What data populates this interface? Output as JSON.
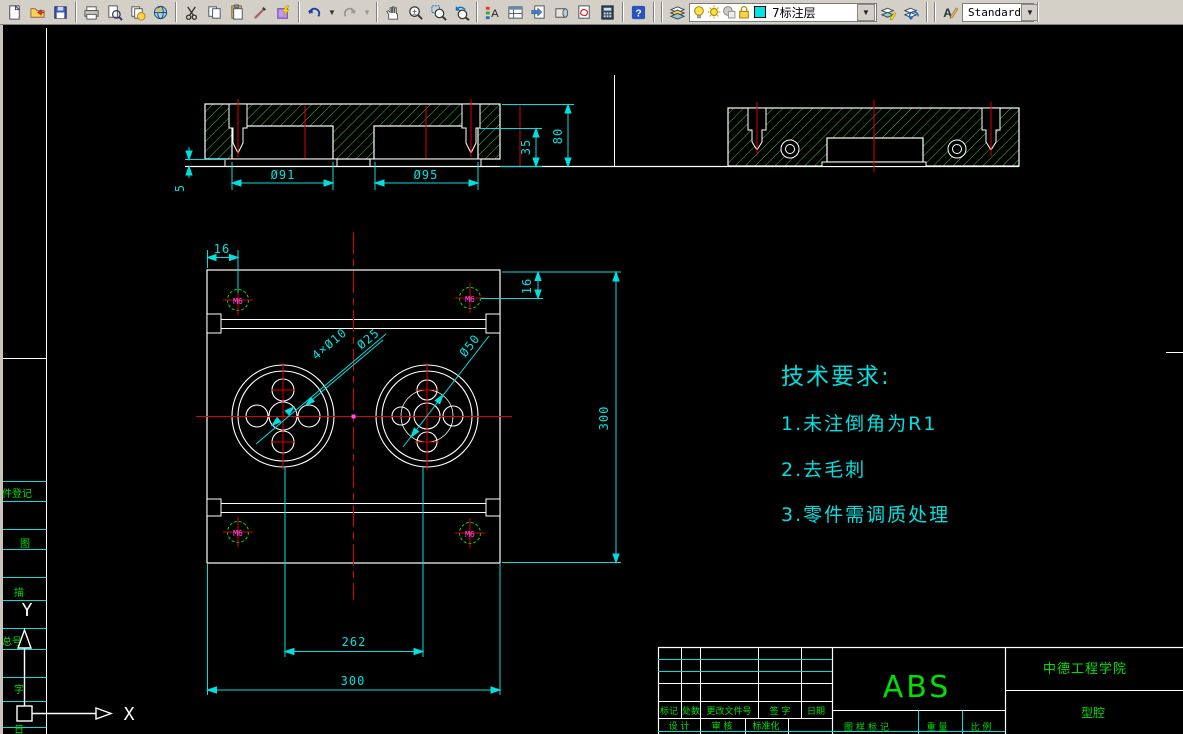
{
  "toolbar": {
    "button_groups": [
      [
        "new-file",
        "open",
        "save"
      ],
      [
        "print",
        "plot-preview",
        "publish",
        "web"
      ],
      [
        "cut",
        "copy",
        "paste",
        "match-properties",
        "block-editor"
      ],
      [
        "undo",
        "undo-dropdown",
        "redo",
        "redo-dropdown"
      ],
      [
        "pan",
        "zoom-realtime",
        "zoom-window",
        "zoom-previous"
      ],
      [
        "properties",
        "design-center",
        "tool-palettes",
        "sheet-set-manager",
        "markup-set-manager",
        "quick-calc"
      ],
      [
        "help"
      ]
    ],
    "layer_panel": {
      "layers_button": "layers",
      "combo": {
        "state_icons": [
          "bulb",
          "sun",
          "vp-freeze",
          "lock"
        ],
        "swatch_color": "#00E5E5",
        "value": "7标注层"
      },
      "after_buttons": [
        "layer-make-current",
        "layer-previous"
      ]
    },
    "style_panel": {
      "text_style_button": "text-style",
      "combo_value": "Standard",
      "dim_style_button": "dim-style"
    }
  },
  "drawing": {
    "dims": {
      "d91": "Ø91",
      "d95": "Ø95",
      "h80": "80",
      "h35": "35",
      "h5": "5",
      "w16_top": "16",
      "h16_right": "16",
      "bolt_circle_holes": "4×Ø10",
      "d25": "Ø25",
      "d50": "Ø50",
      "w262": "262",
      "w300_bottom": "300",
      "h300_right": "300"
    },
    "hole_label": "M6",
    "tech": {
      "title": "技术要求:",
      "items": [
        "1.未注倒角为R1",
        "2.去毛刺",
        "3.零件需调质处理"
      ]
    },
    "title_block": {
      "material": "ABS",
      "company": "中德工程学院",
      "part_name": "型腔",
      "row1": [
        "标记",
        "处数",
        "更改文件号",
        "签 字",
        "日期"
      ],
      "row2": [
        "设 计",
        "审 核",
        "标准化"
      ],
      "bottom": [
        "图样标记",
        "重 量",
        "比 例"
      ]
    },
    "left_fragments": [
      "件登记",
      "图",
      "描",
      "总号",
      "字",
      "日"
    ],
    "ucs": {
      "x_label": "X",
      "y_label": "Y"
    }
  },
  "colors": {
    "background": "#000000",
    "outline": "#FFFFFF",
    "dimension": "#00E0E0",
    "centerline": "#E00000",
    "hatch": "#3CC43C",
    "annotation_green": "#00E000",
    "thread_label": "#FF4CFF"
  }
}
